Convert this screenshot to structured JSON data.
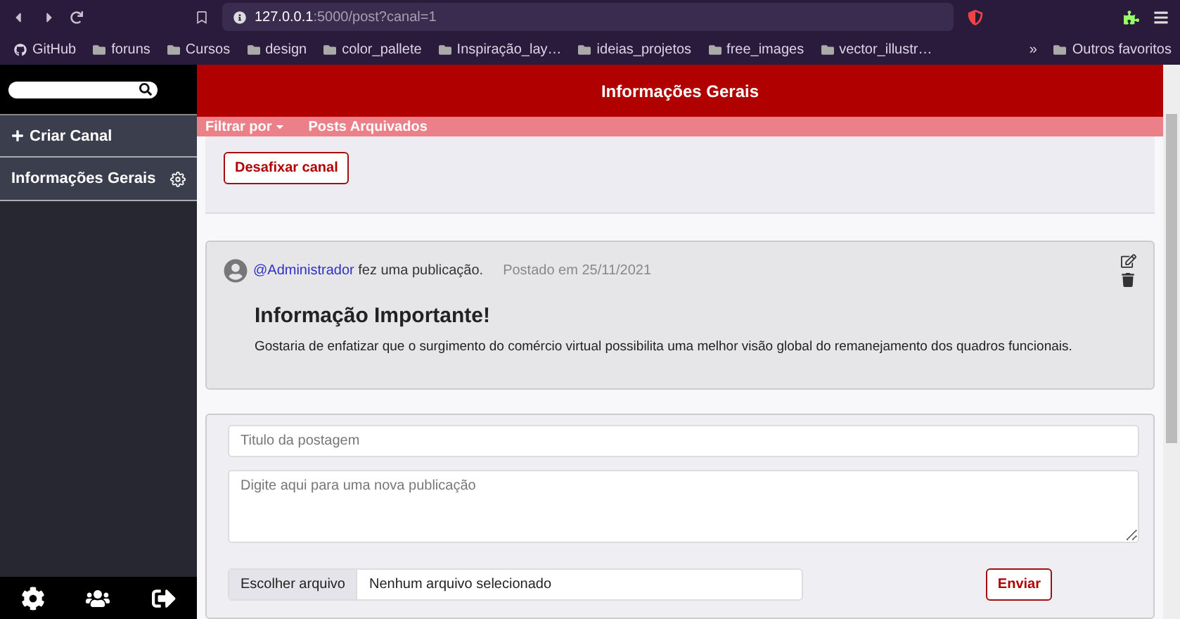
{
  "browser": {
    "url": "**127.0.0.1**:5000/post?canal=1",
    "bookmarks": [
      {
        "label": "GitHub",
        "kind": "site"
      },
      {
        "label": "foruns",
        "kind": "folder"
      },
      {
        "label": "Cursos",
        "kind": "folder"
      },
      {
        "label": "design",
        "kind": "folder"
      },
      {
        "label": "color_pallete",
        "kind": "folder"
      },
      {
        "label": "Inspiração_lay…",
        "kind": "folder"
      },
      {
        "label": "ideias_projetos",
        "kind": "folder"
      },
      {
        "label": "free_images",
        "kind": "folder"
      },
      {
        "label": "vector_illustr…",
        "kind": "folder"
      }
    ],
    "more": "»",
    "other_bookmarks": "Outros favoritos"
  },
  "sidebar": {
    "create_channel": "Criar Canal",
    "channels": [
      {
        "name": "Informações Gerais",
        "selected": true
      }
    ]
  },
  "header": {
    "title": "Informações Gerais"
  },
  "subnav": {
    "filter": "Filtrar por",
    "archived": "Posts Arquivados"
  },
  "pinned": {
    "button": "Desafixar canal"
  },
  "posts": [
    {
      "author": "@Administrador",
      "action": "fez uma publicação.",
      "date": "Postado em 25/11/2021",
      "title": "Informação Importante!",
      "body": "Gostaria de enfatizar que o surgimento do comércio virtual possibilita uma melhor visão global do remanejamento dos quadros funcionais."
    }
  ],
  "composer": {
    "title_placeholder": "Titulo da postagem",
    "body_placeholder": "Digite aqui para uma nova publicação",
    "file_button": "Escolher arquivo",
    "file_status": "Nenhum arquivo selecionado",
    "submit": "Enviar"
  }
}
